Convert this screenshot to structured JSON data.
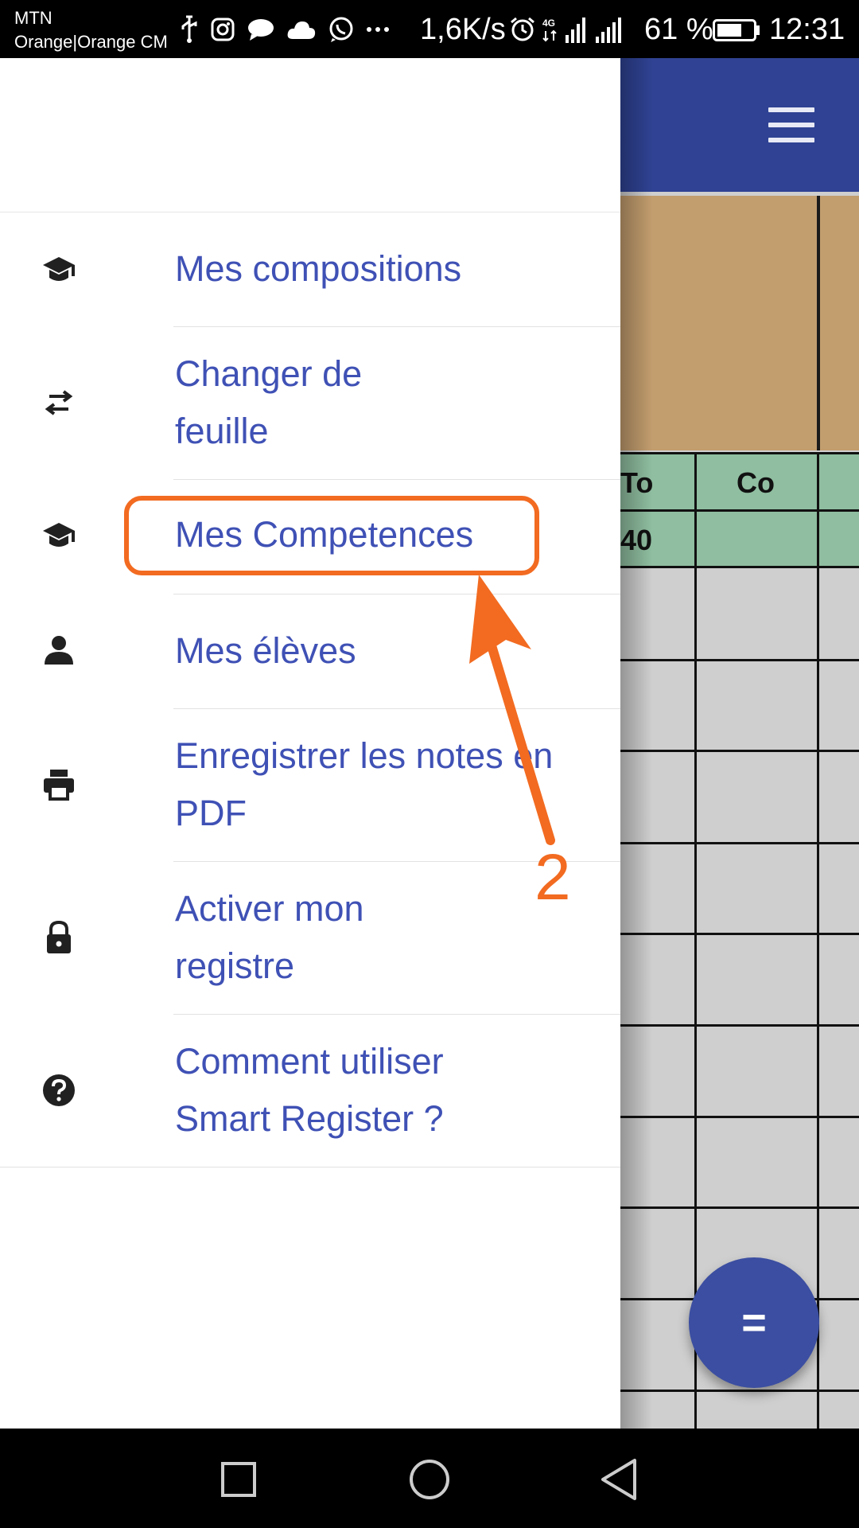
{
  "status_bar": {
    "carrier_line1": "MTN",
    "carrier_line2": "Orange|Orange CM",
    "net_speed": "1,6K/s",
    "battery_percent": "61 %",
    "time": "12:31",
    "network_badge": "4G",
    "icons": [
      "usb-icon",
      "instagram-icon",
      "chat-bubble-icon",
      "cloud-icon",
      "whatsapp-icon",
      "more-icon",
      "alarm-icon",
      "signal-icon",
      "battery-icon"
    ]
  },
  "app": {
    "toolbar_color": "#2f4293",
    "table": {
      "headers": [
        "To",
        "Co"
      ],
      "values": [
        "40",
        ""
      ]
    },
    "fab_label": "="
  },
  "drawer": {
    "items": [
      {
        "label": "Mes compositions",
        "icon": "graduation-cap-icon"
      },
      {
        "label": "Changer de\nfeuille",
        "icon": "swap-arrows-icon"
      },
      {
        "label": "Mes Competences",
        "icon": "graduation-cap-icon"
      },
      {
        "label": "Mes élèves",
        "icon": "person-icon"
      },
      {
        "label": "Enregistrer les notes en PDF",
        "icon": "printer-icon"
      },
      {
        "label": "Activer mon\nregistre",
        "icon": "lock-icon"
      },
      {
        "label": "Comment utiliser\nSmart Register ?",
        "icon": "help-circle-icon"
      }
    ]
  },
  "annotation": {
    "number": "2",
    "color": "#f26b21"
  },
  "nav_bar": {
    "buttons": [
      "recents-square-icon",
      "home-circle-icon",
      "back-triangle-icon"
    ]
  }
}
